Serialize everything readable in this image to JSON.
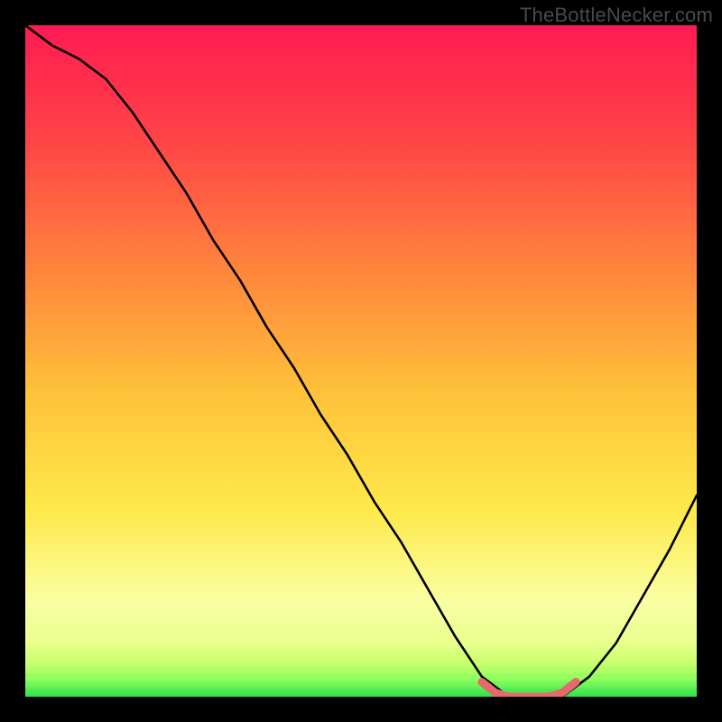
{
  "watermark": "TheBottleNecker.com",
  "colors": {
    "bg": "#000000",
    "curve": "#000000",
    "basin": "#e46a6d",
    "green": "#2fe04b",
    "watermark": "#4a4a4a",
    "grad_top": "#ff1a52",
    "grad_upper": "#ff6a3d",
    "grad_mid": "#ffc23a",
    "grad_lower": "#ffe94a",
    "grad_pale": "#f9ffa3"
  },
  "chart_data": {
    "type": "line",
    "title": "",
    "xlabel": "",
    "ylabel": "",
    "xlim": [
      0,
      100
    ],
    "ylim": [
      0,
      100
    ],
    "legend": null,
    "series": [
      {
        "name": "bottleneck-curve",
        "x": [
          0,
          4,
          8,
          12,
          16,
          20,
          24,
          28,
          32,
          36,
          40,
          44,
          48,
          52,
          56,
          60,
          64,
          68,
          72,
          76,
          80,
          84,
          88,
          92,
          96,
          100
        ],
        "y": [
          100,
          97,
          95,
          92,
          87,
          81,
          75,
          68,
          62,
          55,
          49,
          42,
          36,
          29,
          23,
          16,
          9,
          3,
          0,
          0,
          0,
          3,
          8,
          15,
          22,
          30
        ]
      },
      {
        "name": "basin-marker",
        "x": [
          68,
          70,
          72,
          74,
          76,
          78,
          80,
          82
        ],
        "y": [
          2.2,
          0.6,
          0,
          0,
          0,
          0,
          0.6,
          2.2
        ]
      }
    ],
    "gradient_bands": [
      {
        "y0": 100,
        "y1": 46,
        "from": "#ff1a52",
        "to": "#ffc23a"
      },
      {
        "y0": 46,
        "y1": 20,
        "from": "#ffc23a",
        "to": "#ffe94a"
      },
      {
        "y0": 20,
        "y1": 8,
        "from": "#ffe94a",
        "to": "#f9ffa3"
      },
      {
        "y0": 8,
        "y1": 3,
        "from": "#f9ffa3",
        "to": "#d8ff7c"
      },
      {
        "y0": 3,
        "y1": 0,
        "from": "#8dff5e",
        "to": "#2fe04b"
      }
    ]
  }
}
